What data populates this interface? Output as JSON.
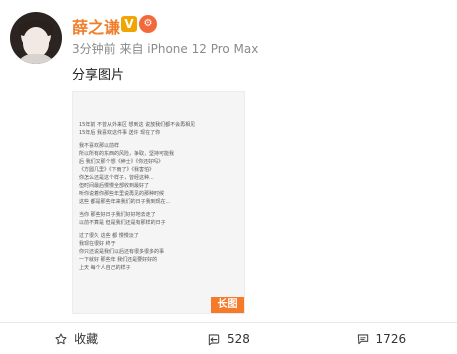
{
  "user": {
    "name": "薛之谦",
    "verified_badge": "V",
    "level_badge": "⚙"
  },
  "post": {
    "time": "3分钟前",
    "source": "来自 iPhone 12 Pro Max",
    "text": "分享图片",
    "image": {
      "long_tag": "长图",
      "lines": [
        "15年前 不曾从外来区 想到这 说放我们都不会再相见",
        "15年后 我喜欢这件事 送许 现在了你",
        "",
        "我不喜欢那以前样",
        "所以所有的东西的风险，争取，坚持可能我",
        "后 我们又那个想《绅士》《你还好吗》",
        "《方圆几里》《下雨了》《我害怕》",
        "你怎么还是这个样子，曾经这种...",
        "但时间最后慢慢全部收到最好了",
        "听你说着你那些年里说再见的那种时候",
        "这些 都是那些年来我们的日子我到现在...",
        "",
        "当你 那些好日子我们好好地去走了",
        "以前不算是 但是我们还是有那样的日子",
        "",
        "过了很久 这些 都 慢慢淡了",
        "我现在很好 终于",
        "你只还说是我们以后还有很多很多的事",
        "一下就好 那些年 我们还是要好好的",
        "上天 每个人自己的样子"
      ]
    }
  },
  "actions": {
    "favorite_label": "收藏",
    "repost_count": "528",
    "comment_count": "1726"
  }
}
